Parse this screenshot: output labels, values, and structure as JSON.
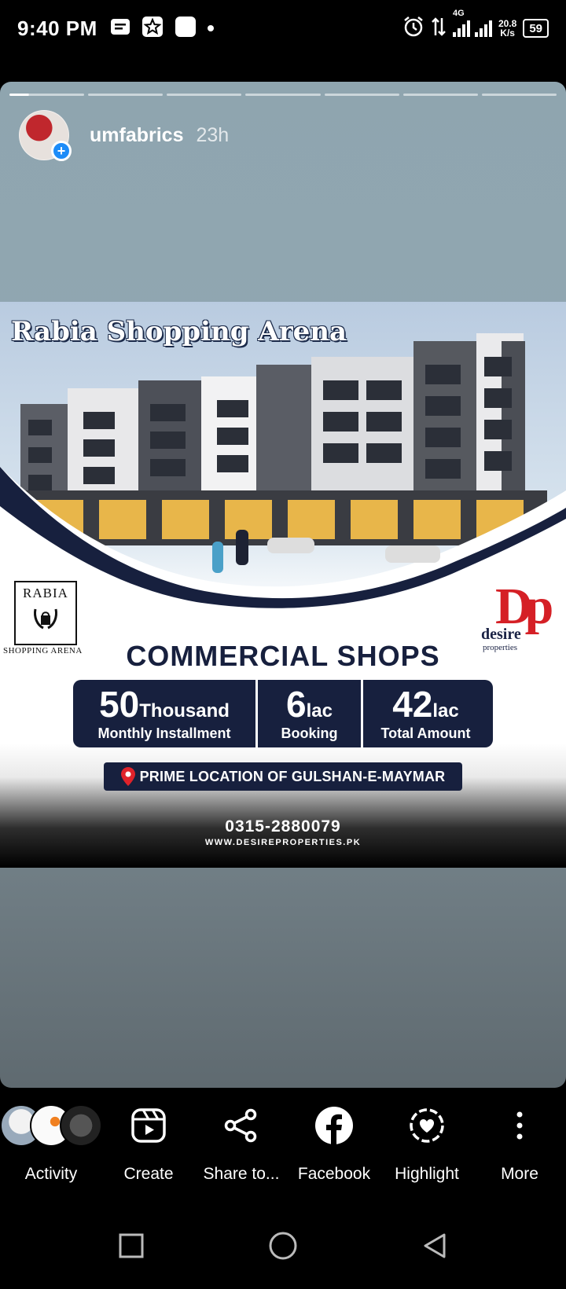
{
  "status_bar": {
    "time": "9:40 PM",
    "network_type": "4G",
    "speed_value": "20.8",
    "speed_unit": "K/s",
    "battery": "59",
    "icons": [
      "message-icon",
      "star-app-icon",
      "app-square-icon",
      "dot-icon",
      "alarm-icon",
      "data-arrows-icon",
      "signal-icon",
      "battery-icon"
    ]
  },
  "story": {
    "segments_total": 7,
    "active_segment": 1,
    "username": "umfabrics",
    "time_ago": "23h"
  },
  "ad": {
    "title": "Rabia Shopping Arena",
    "rabia_logo_name": "RABIA",
    "rabia_logo_sub": "SHOPPING ARENA",
    "dp_letters": "Dp",
    "dp_desire": "desire",
    "dp_properties": "properties",
    "heading": "COMMERCIAL SHOPS",
    "installment_amount": "50",
    "installment_unit": "Thousand",
    "installment_label": "Monthly Installment",
    "booking_amount": "6",
    "booking_unit": "lac",
    "booking_label": "Booking",
    "total_amount": "42",
    "total_unit": "lac",
    "total_label": "Total Amount",
    "location": "PRIME LOCATION OF GULSHAN-E-MAYMAR",
    "phone": "0315-2880079",
    "website": "WWW.DESIREPROPERTIES.PK",
    "colors": {
      "navy": "#17203e",
      "red": "#d52026"
    }
  },
  "actions": [
    {
      "label": "Activity",
      "icon": "activity-avatars"
    },
    {
      "label": "Create",
      "icon": "reels-icon"
    },
    {
      "label": "Share to...",
      "icon": "share-icon"
    },
    {
      "label": "Facebook",
      "icon": "facebook-icon"
    },
    {
      "label": "Highlight",
      "icon": "highlight-icon"
    },
    {
      "label": "More",
      "icon": "more-vertical-icon"
    }
  ],
  "nav": [
    "recents-icon",
    "home-icon",
    "back-icon"
  ]
}
